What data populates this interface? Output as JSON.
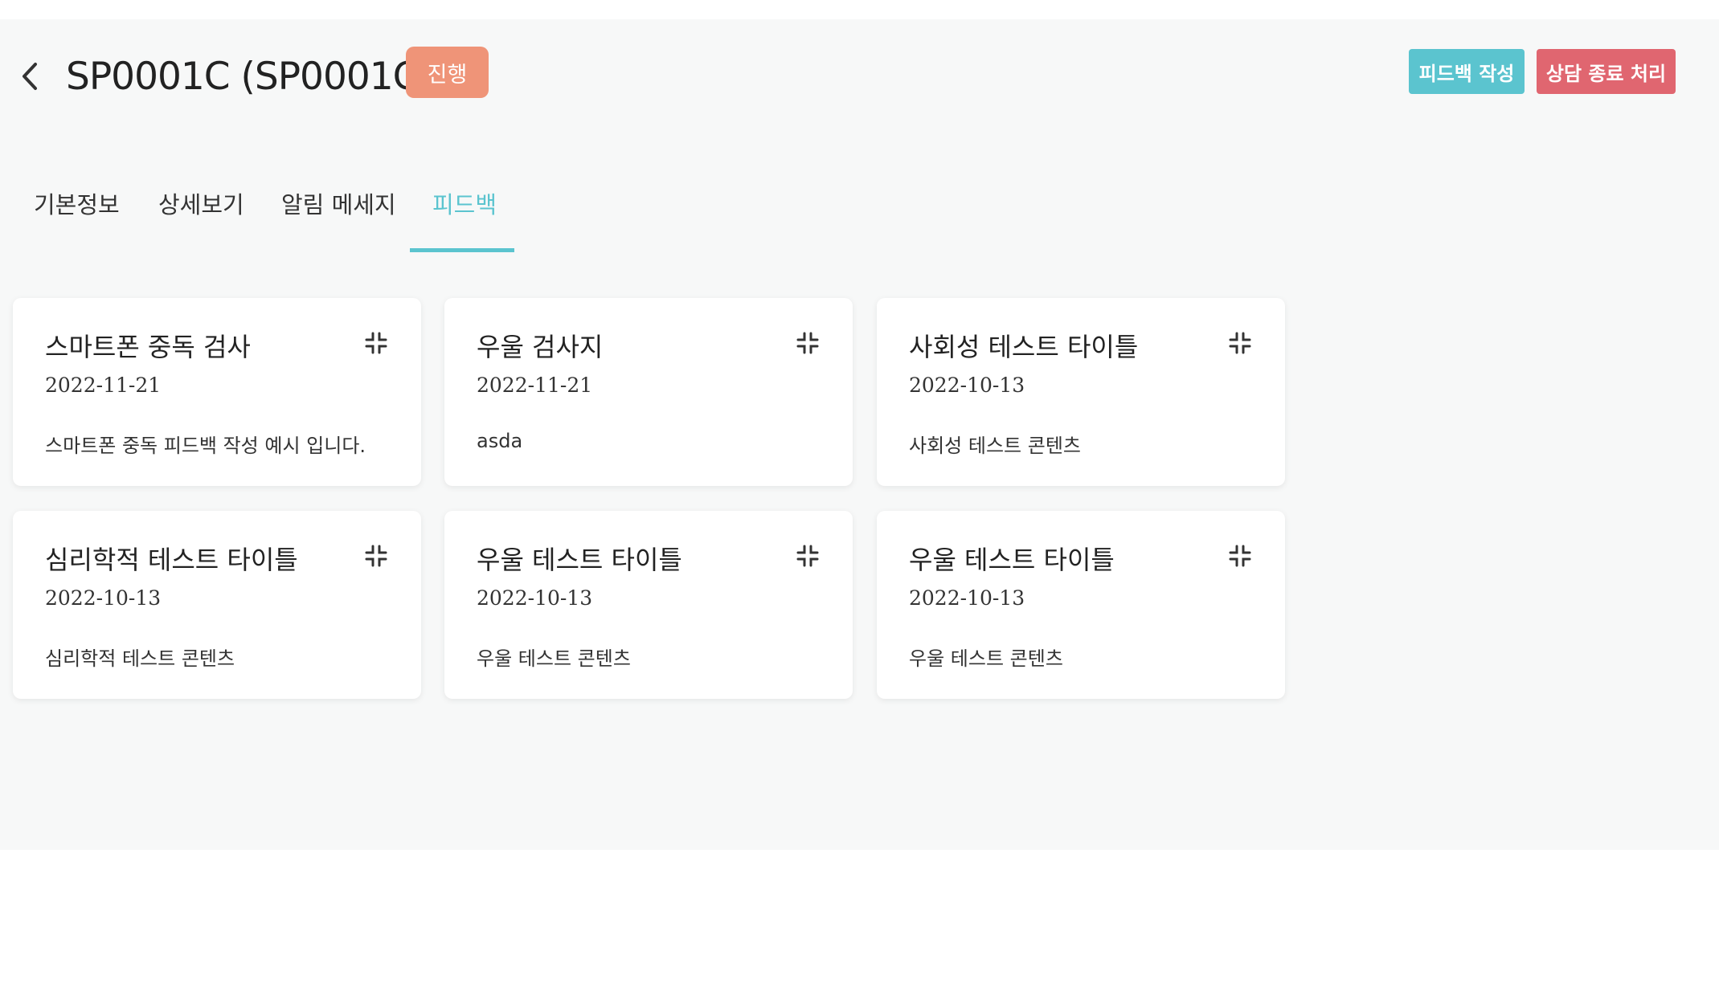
{
  "header": {
    "title": "SP0001C (SP0001C1)",
    "status_badge": "진행",
    "buttons": {
      "write_feedback": "피드백 작성",
      "end_consultation": "상담 종료 처리"
    }
  },
  "tabs": [
    {
      "label": "기본정보",
      "active": false
    },
    {
      "label": "상세보기",
      "active": false
    },
    {
      "label": "알림 메세지",
      "active": false
    },
    {
      "label": "피드백",
      "active": true
    }
  ],
  "cards": [
    {
      "title": "스마트폰 중독 검사",
      "date": "2022-11-21",
      "content": "스마트폰 중독 피드백 작성 예시 입니다."
    },
    {
      "title": "우울 검사지",
      "date": "2022-11-21",
      "content": "asda"
    },
    {
      "title": "사회성 테스트 타이틀",
      "date": "2022-10-13",
      "content": "사회성 테스트 콘텐츠"
    },
    {
      "title": "심리학적 테스트 타이틀",
      "date": "2022-10-13",
      "content": "심리학적 테스트 콘텐츠"
    },
    {
      "title": "우울 테스트 타이틀",
      "date": "2022-10-13",
      "content": "우울 테스트 콘텐츠"
    },
    {
      "title": "우울 테스트 타이틀",
      "date": "2022-10-13",
      "content": "우울 테스트 콘텐츠"
    }
  ],
  "icons": {
    "back": "chevron-left-icon",
    "card_action": "collapse-icon"
  },
  "colors": {
    "accent": "#5bc4cf",
    "status_badge": "#ef9478",
    "danger": "#e06670",
    "background": "#f7f8f8"
  }
}
